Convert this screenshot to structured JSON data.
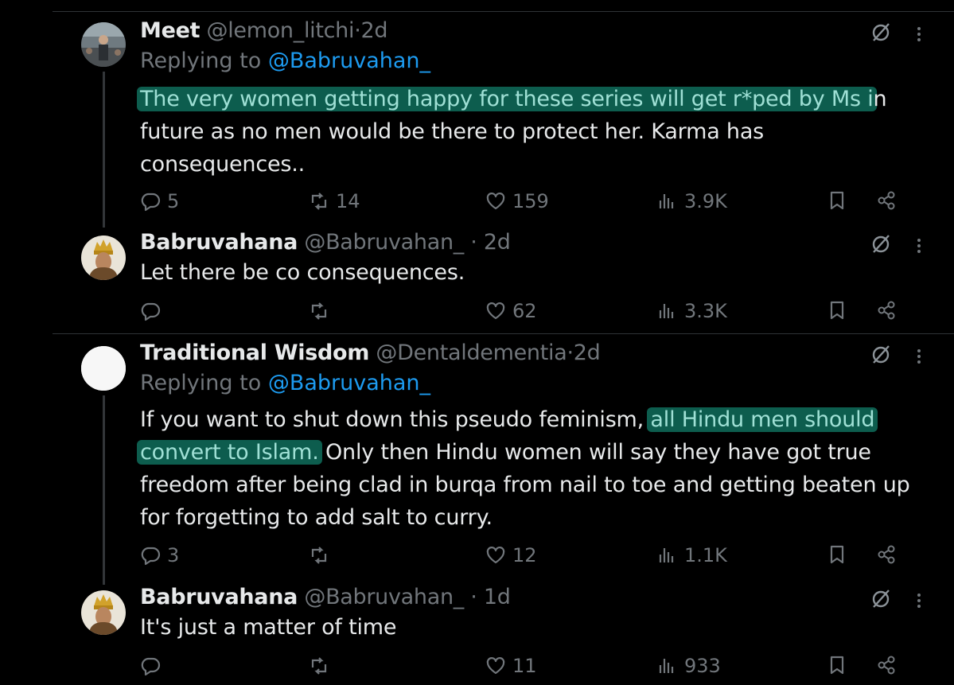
{
  "tweets": [
    {
      "name": "Meet",
      "handle": "@lemon_litchi",
      "sep": "·",
      "time": "2d",
      "replying_prefix": "Replying to",
      "replying_to": "@Babruvahan_",
      "body_highlight": "The very women getting happy for these series will get r*ped by Ms i",
      "body_rest": "n future as no men would be there to protect her. Karma has consequences..",
      "replies": "5",
      "reposts": "14",
      "likes": "159",
      "views": "3.9K"
    },
    {
      "name": "Babruvahana",
      "handle": "@Babruvahan_",
      "sep": "·",
      "time": "2d",
      "body": "Let there be co consequences.",
      "replies": "",
      "reposts": "",
      "likes": "62",
      "views": "3.3K"
    },
    {
      "name": "Traditional Wisdom",
      "handle": "@Dentaldementia",
      "sep": "·",
      "time": "2d",
      "replying_prefix": "Replying to",
      "replying_to": "@Babruvahan_",
      "body_part1": "If you want to shut down this pseudo feminism, ",
      "body_highlight1": "all Hindu men should",
      "body_highlight2": "convert to Islam.",
      "body_part2": " Only then Hindu women will say they have got true freedom after being clad in burqa from nail to toe and getting beaten up for forgetting to add salt to curry.",
      "replies": "3",
      "reposts": "",
      "likes": "12",
      "views": "1.1K"
    },
    {
      "name": "Babruvahana",
      "handle": "@Babruvahan_",
      "sep": "·",
      "time": "1d",
      "body": "It's just a matter of time",
      "replies": "",
      "reposts": "",
      "likes": "11",
      "views": "933"
    }
  ],
  "icons": {
    "reply": "reply-icon",
    "repost": "repost-icon",
    "like": "heart-icon",
    "views": "views-icon",
    "bookmark": "bookmark-icon",
    "share": "share-icon",
    "grok": "grok-icon",
    "more": "more-icon"
  },
  "colors": {
    "background": "#000000",
    "text": "#e7e9ea",
    "secondary": "#71767b",
    "link": "#1d9bf0",
    "highlight": "#0d5d4e"
  }
}
